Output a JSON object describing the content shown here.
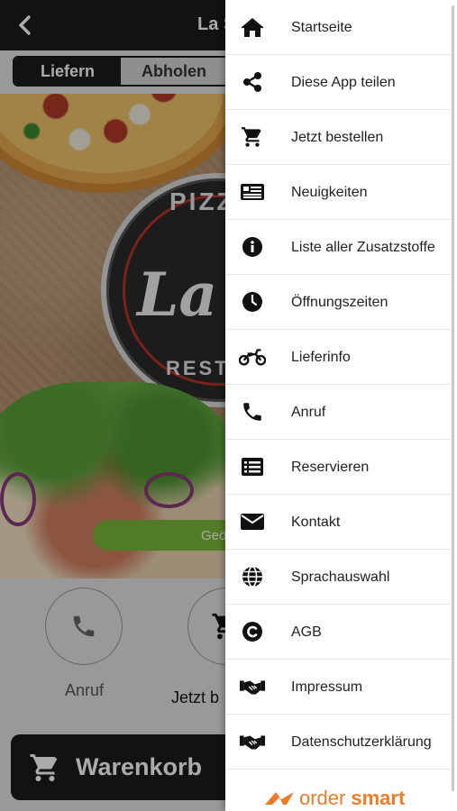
{
  "app": {
    "title": "La S",
    "order_mode": {
      "deliver_label": "Liefern",
      "pickup_label": "Abholen"
    },
    "hero": {
      "logo_top": "PIZZ",
      "logo_middle": "La",
      "logo_bottom": "RESTA",
      "status_pill": "Geö"
    },
    "actions": {
      "call_label": "Anruf",
      "order_label": "Jetzt b"
    },
    "cart_label": "Warenkorb"
  },
  "drawer": {
    "items": [
      {
        "label": "Startseite",
        "icon": "home-icon"
      },
      {
        "label": "Diese App teilen",
        "icon": "share-icon"
      },
      {
        "label": "Jetzt bestellen",
        "icon": "cart-icon"
      },
      {
        "label": "Neuigkeiten",
        "icon": "news-icon"
      },
      {
        "label": "Liste aller Zusatzstoffe",
        "icon": "info-icon"
      },
      {
        "label": "Öffnungszeiten",
        "icon": "clock-icon"
      },
      {
        "label": "Lieferinfo",
        "icon": "motorcycle-icon"
      },
      {
        "label": "Anruf",
        "icon": "phone-icon"
      },
      {
        "label": "Reservieren",
        "icon": "list-icon"
      },
      {
        "label": "Kontakt",
        "icon": "envelope-icon"
      },
      {
        "label": "Sprachauswahl",
        "icon": "globe-icon"
      },
      {
        "label": "AGB",
        "icon": "copyright-icon"
      },
      {
        "label": "Impressum",
        "icon": "handshake-icon"
      },
      {
        "label": "Datenschutzerklärung",
        "icon": "handshake-icon"
      }
    ],
    "brand": {
      "word1": "order",
      "word2": "smart"
    }
  },
  "colors": {
    "dark": "#1c1c1c",
    "accent_green": "#7bb83a",
    "brand_orange": "#f07b27"
  }
}
